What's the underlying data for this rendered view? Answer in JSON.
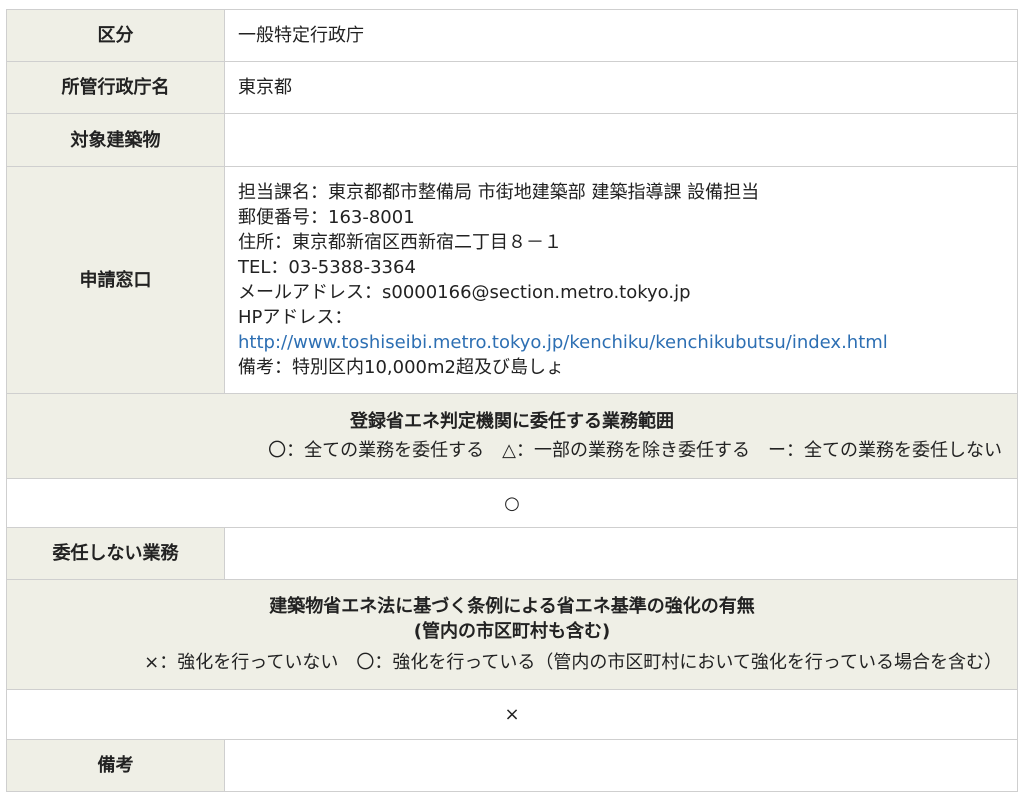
{
  "rows": {
    "kubun": {
      "label": "区分",
      "value": "一般特定行政庁"
    },
    "chosha": {
      "label": "所管行政庁名",
      "value": "東京都"
    },
    "taisho": {
      "label": "対象建築物",
      "value": ""
    },
    "madoguchi": {
      "label": "申請窓口",
      "lines": [
        "担当課名：東京都都市整備局 市街地建築部 建築指導課 設備担当",
        "郵便番号：163-8001",
        "住所：東京都新宿区西新宿二丁目８－１",
        "TEL：03-5388-3364",
        "メールアドレス：s0000166@section.metro.tokyo.jp",
        "HPアドレス："
      ],
      "link": "http://www.toshiseibi.metro.tokyo.jp/kenchiku/kenchikubutsu/index.html",
      "note": "備考：特別区内10,000m2超及び島しょ"
    },
    "inin_header": {
      "title": "登録省エネ判定機関に委任する業務範囲",
      "legend": "〇：全ての業務を委任する　△：一部の業務を除き委任する　ー：全ての業務を委任しない"
    },
    "inin_value": "○",
    "not_inin": {
      "label": "委任しない業務",
      "value": ""
    },
    "kyoka_header": {
      "title1": "建築物省エネ法に基づく条例による省エネ基準の強化の有無",
      "title2": "(管内の市区町村も含む)",
      "legend": "×：強化を行っていない　〇：強化を行っている（管内の市区町村において強化を行っている場合を含む）"
    },
    "kyoka_value": "×",
    "biko": {
      "label": "備考",
      "value": ""
    }
  }
}
